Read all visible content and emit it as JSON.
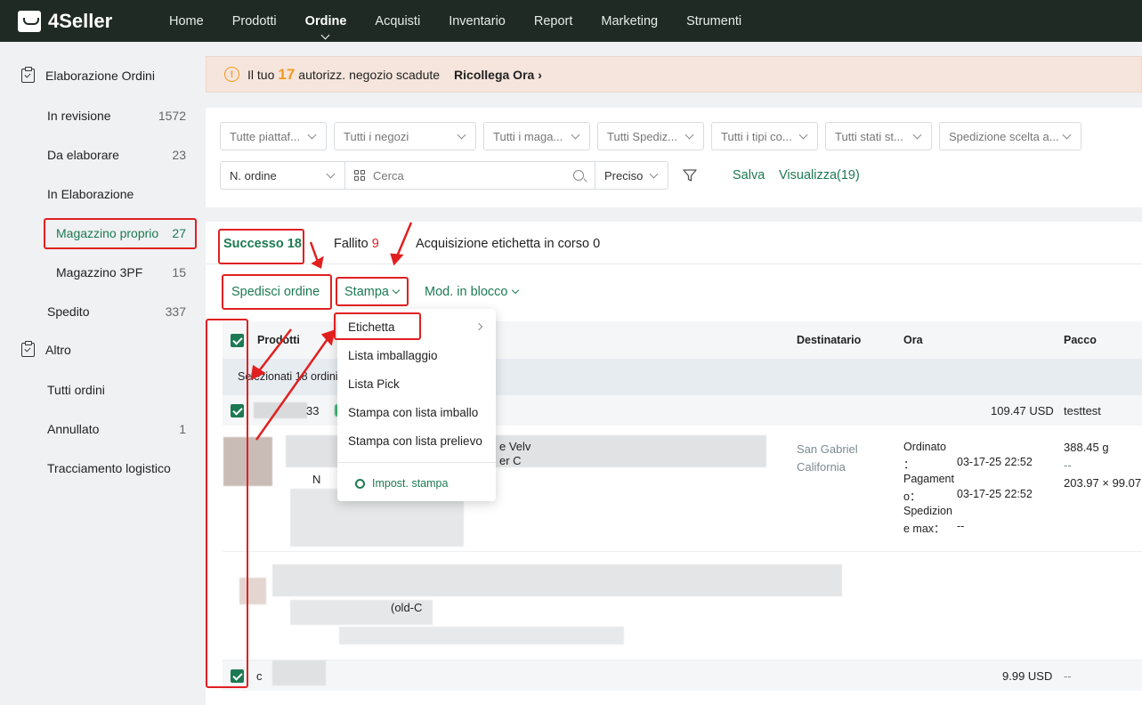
{
  "brand": {
    "name": "4Seller"
  },
  "nav": {
    "items": [
      {
        "label": "Home"
      },
      {
        "label": "Prodotti"
      },
      {
        "label": "Ordine"
      },
      {
        "label": "Acquisti"
      },
      {
        "label": "Inventario"
      },
      {
        "label": "Report"
      },
      {
        "label": "Marketing"
      },
      {
        "label": "Strumenti"
      }
    ],
    "active": "Ordine"
  },
  "sidebar": {
    "group1": "Elaborazione Ordini",
    "items": [
      {
        "label": "In revisione",
        "count": "1572"
      },
      {
        "label": "Da elaborare",
        "count": "23"
      },
      {
        "label": "In Elaborazione",
        "count": ""
      },
      {
        "label": "Magazzino proprio",
        "count": "27"
      },
      {
        "label": "Magazzino 3PF",
        "count": "15"
      },
      {
        "label": "Spedito",
        "count": "337"
      }
    ],
    "group2": "Altro",
    "items2": [
      {
        "label": "Tutti ordini",
        "count": ""
      },
      {
        "label": "Annullato",
        "count": "1"
      },
      {
        "label": "Tracciamento logistico",
        "count": ""
      }
    ]
  },
  "alert": {
    "prefix": "Il tuo",
    "count": "17",
    "suffix": "autorizz. negozio scadute",
    "link": "Ricollega Ora"
  },
  "filters": {
    "selects": [
      "Tutte piattaf...",
      "Tutti i negozi",
      "Tutti i maga...",
      "Tutti Spediz...",
      "Tutti i tipi co...",
      "Tutti stati st...",
      "Spedizione scelta a..."
    ],
    "order_field": "N. ordine",
    "search_placeholder": "Cerca",
    "match_mode": "Preciso",
    "save": "Salva",
    "view": "Visualizza(19)"
  },
  "tabs": {
    "success_label": "Successo",
    "success_count": "18",
    "failed_label": "Fallito",
    "failed_count": "9",
    "pending": "Acquisizione etichetta in corso 0"
  },
  "actions": {
    "ship": "Spedisci ordine",
    "print": "Stampa",
    "bulk": "Mod. in blocco"
  },
  "table": {
    "headers": {
      "products": "Prodotti",
      "recipient": "Destinatario",
      "time": "Ora",
      "package": "Pacco"
    },
    "selected": "Selezionati 18 ordini",
    "row1": {
      "id_tail": "33",
      "amount": "109.47 USD",
      "carrier": "testtest",
      "product_frag1": "e Velv",
      "product_frag2": "er C",
      "product_frag3": "N",
      "city": "San Gabriel",
      "state": "California",
      "ordered_label": "Ordinato",
      "ordered_colon": "：",
      "ordered_value": "03-17-25 22:52",
      "paid_label": "Pagament",
      "paid_label2": "o：",
      "paid_value": "03-17-25 22:52",
      "ship_label": "Spedizion",
      "ship_label2": "e max：",
      "ship_value": "--",
      "weight": "388.45 g",
      "weight2": "--",
      "dims": "203.97 × 99.07"
    },
    "row2": {
      "frag": "(old-C",
      "id_head": "c",
      "amount": "9.99 USD",
      "carrier": "--"
    }
  },
  "dropdown": {
    "items": [
      "Etichetta",
      "Lista imballaggio",
      "Lista Pick",
      "Stampa con lista imballo",
      "Stampa con lista prelievo"
    ],
    "settings": "Impost. stampa"
  }
}
